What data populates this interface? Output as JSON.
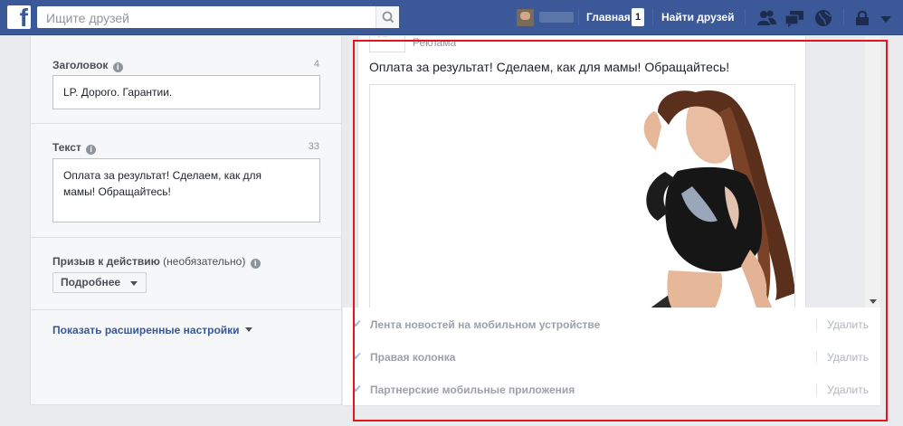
{
  "topbar": {
    "logo": "f",
    "search_placeholder": "Ищите друзей",
    "home_label": "Главная",
    "home_badge": "1",
    "find_friends_label": "Найти друзей"
  },
  "form": {
    "headline": {
      "label": "Заголовок",
      "count": "4",
      "value": "LP. Дорого. Гарантии."
    },
    "text": {
      "label": "Текст",
      "count": "33",
      "value_line1": "Оплата за результат! Сделаем, как для",
      "value_line2": "мамы! Обращайтесь!"
    },
    "cta": {
      "label": "Призыв к действию",
      "optional": "(необязательно)",
      "selected": "Подробнее"
    },
    "advanced_label": "Показать расширенные настройки"
  },
  "ad_preview": {
    "sponsored_label": "Реклама",
    "text": "Оплата за результат! Сделаем, как для мамы! Обращайтесь!"
  },
  "placements": [
    {
      "name": "Лента новостей на мобильном устройстве",
      "remove_label": "Удалить"
    },
    {
      "name": "Правая колонка",
      "remove_label": "Удалить"
    },
    {
      "name": "Партнерские мобильные приложения",
      "remove_label": "Удалить"
    }
  ],
  "colors": {
    "brand": "#3b5998",
    "highlight": "#e8141c",
    "link": "#365899"
  },
  "icons": [
    "facebook-logo-icon",
    "search-icon",
    "friend-requests-icon",
    "messages-icon",
    "notifications-icon",
    "privacy-icon",
    "dropdown-icon",
    "info-icon",
    "check-icon"
  ]
}
